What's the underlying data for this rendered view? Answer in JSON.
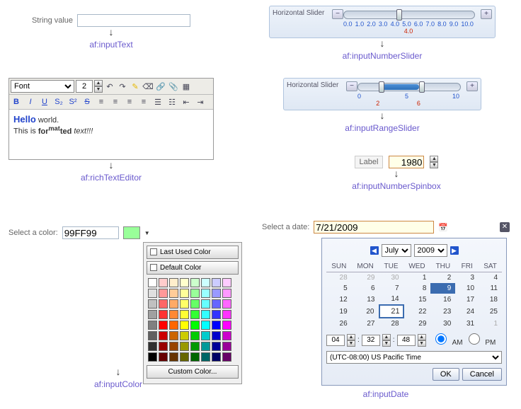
{
  "captions": {
    "inputText": "af:inputText",
    "richText": "af:richTextEditor",
    "inputColor": "af:inputColor",
    "numberSlider": "af:inputNumberSlider",
    "rangeSlider": "af:inputRangeSlider",
    "spinbox": "af:inputNumberSpinbox",
    "inputDate": "af:inputDate"
  },
  "inputText": {
    "label": "String value"
  },
  "richText": {
    "fontOptions": "Font",
    "size": "2",
    "sample_hello": "Hello",
    "sample_world": " world.",
    "sample_line2a": "This is ",
    "sample_line2b": "for",
    "sample_line2c": "mat",
    "sample_line2d": "ted",
    "sample_line2e": " text!!!"
  },
  "inputColor": {
    "label": "Select a color:",
    "value": "99FF99",
    "swatch": "#99FF99",
    "lastUsed": "Last Used Color",
    "defaultColor": "Default Color",
    "custom": "Custom Color...",
    "palette": [
      "#ffffff",
      "#ffcccc",
      "#ffeecc",
      "#ffffcc",
      "#ccffcc",
      "#ccffff",
      "#ccccff",
      "#ffccff",
      "#e0e0e0",
      "#ff9999",
      "#ffcc99",
      "#ffff99",
      "#99ff99",
      "#99ffff",
      "#9999ff",
      "#ff99ff",
      "#c0c0c0",
      "#ff6666",
      "#ffaa66",
      "#ffff66",
      "#66ff66",
      "#66ffff",
      "#6666ff",
      "#ff66ff",
      "#a0a0a0",
      "#ff3333",
      "#ff8833",
      "#ffff33",
      "#33ff33",
      "#33ffff",
      "#3333ff",
      "#ff33ff",
      "#808080",
      "#ff0000",
      "#ff6600",
      "#ffff00",
      "#00ff00",
      "#00ffff",
      "#0000ff",
      "#ff00ff",
      "#606060",
      "#cc0000",
      "#cc6600",
      "#cccc00",
      "#00cc00",
      "#00cccc",
      "#0000cc",
      "#cc00cc",
      "#303030",
      "#990000",
      "#994400",
      "#999900",
      "#009900",
      "#009999",
      "#000099",
      "#990099",
      "#000000",
      "#660000",
      "#663300",
      "#666600",
      "#006600",
      "#006666",
      "#000066",
      "#660066"
    ]
  },
  "numberSlider": {
    "label": "Horizontal Slider",
    "ticks": [
      "0.0",
      "1.0",
      "2.0",
      "3.0",
      "4.0",
      "5.0",
      "6.0",
      "7.0",
      "8.0",
      "9.0",
      "10.0"
    ],
    "value": "4.0"
  },
  "rangeSlider": {
    "label": "Horizontal Slider",
    "ticks": [
      "0",
      "",
      "",
      "",
      "",
      "5",
      "",
      "",
      "",
      "",
      "10"
    ],
    "low": "2",
    "high": "6"
  },
  "spinbox": {
    "label": "Label",
    "value": "1980"
  },
  "inputDate": {
    "label": "Select a date:",
    "value": "7/21/2009",
    "month": "July",
    "year": "2009",
    "days": [
      "SUN",
      "MON",
      "TUE",
      "WED",
      "THU",
      "FRI",
      "SAT"
    ],
    "weeks": [
      [
        {
          "d": "28",
          "o": 1
        },
        {
          "d": "29",
          "o": 1
        },
        {
          "d": "30",
          "o": 1
        },
        {
          "d": "1"
        },
        {
          "d": "2"
        },
        {
          "d": "3"
        },
        {
          "d": "4"
        }
      ],
      [
        {
          "d": "5"
        },
        {
          "d": "6"
        },
        {
          "d": "7"
        },
        {
          "d": "8"
        },
        {
          "d": "9",
          "today": 1
        },
        {
          "d": "10"
        },
        {
          "d": "11"
        }
      ],
      [
        {
          "d": "12"
        },
        {
          "d": "13"
        },
        {
          "d": "14"
        },
        {
          "d": "15"
        },
        {
          "d": "16"
        },
        {
          "d": "17"
        },
        {
          "d": "18"
        }
      ],
      [
        {
          "d": "19"
        },
        {
          "d": "20"
        },
        {
          "d": "21",
          "sel": 1
        },
        {
          "d": "22"
        },
        {
          "d": "23"
        },
        {
          "d": "24"
        },
        {
          "d": "25"
        }
      ],
      [
        {
          "d": "26"
        },
        {
          "d": "27"
        },
        {
          "d": "28"
        },
        {
          "d": "29"
        },
        {
          "d": "30"
        },
        {
          "d": "31"
        },
        {
          "d": "1",
          "o": 1
        }
      ]
    ],
    "hh": "04",
    "mm": "32",
    "ss": "48",
    "am": "AM",
    "pm": "PM",
    "tz": "(UTC-08:00) US Pacific Time",
    "ok": "OK",
    "cancel": "Cancel"
  }
}
